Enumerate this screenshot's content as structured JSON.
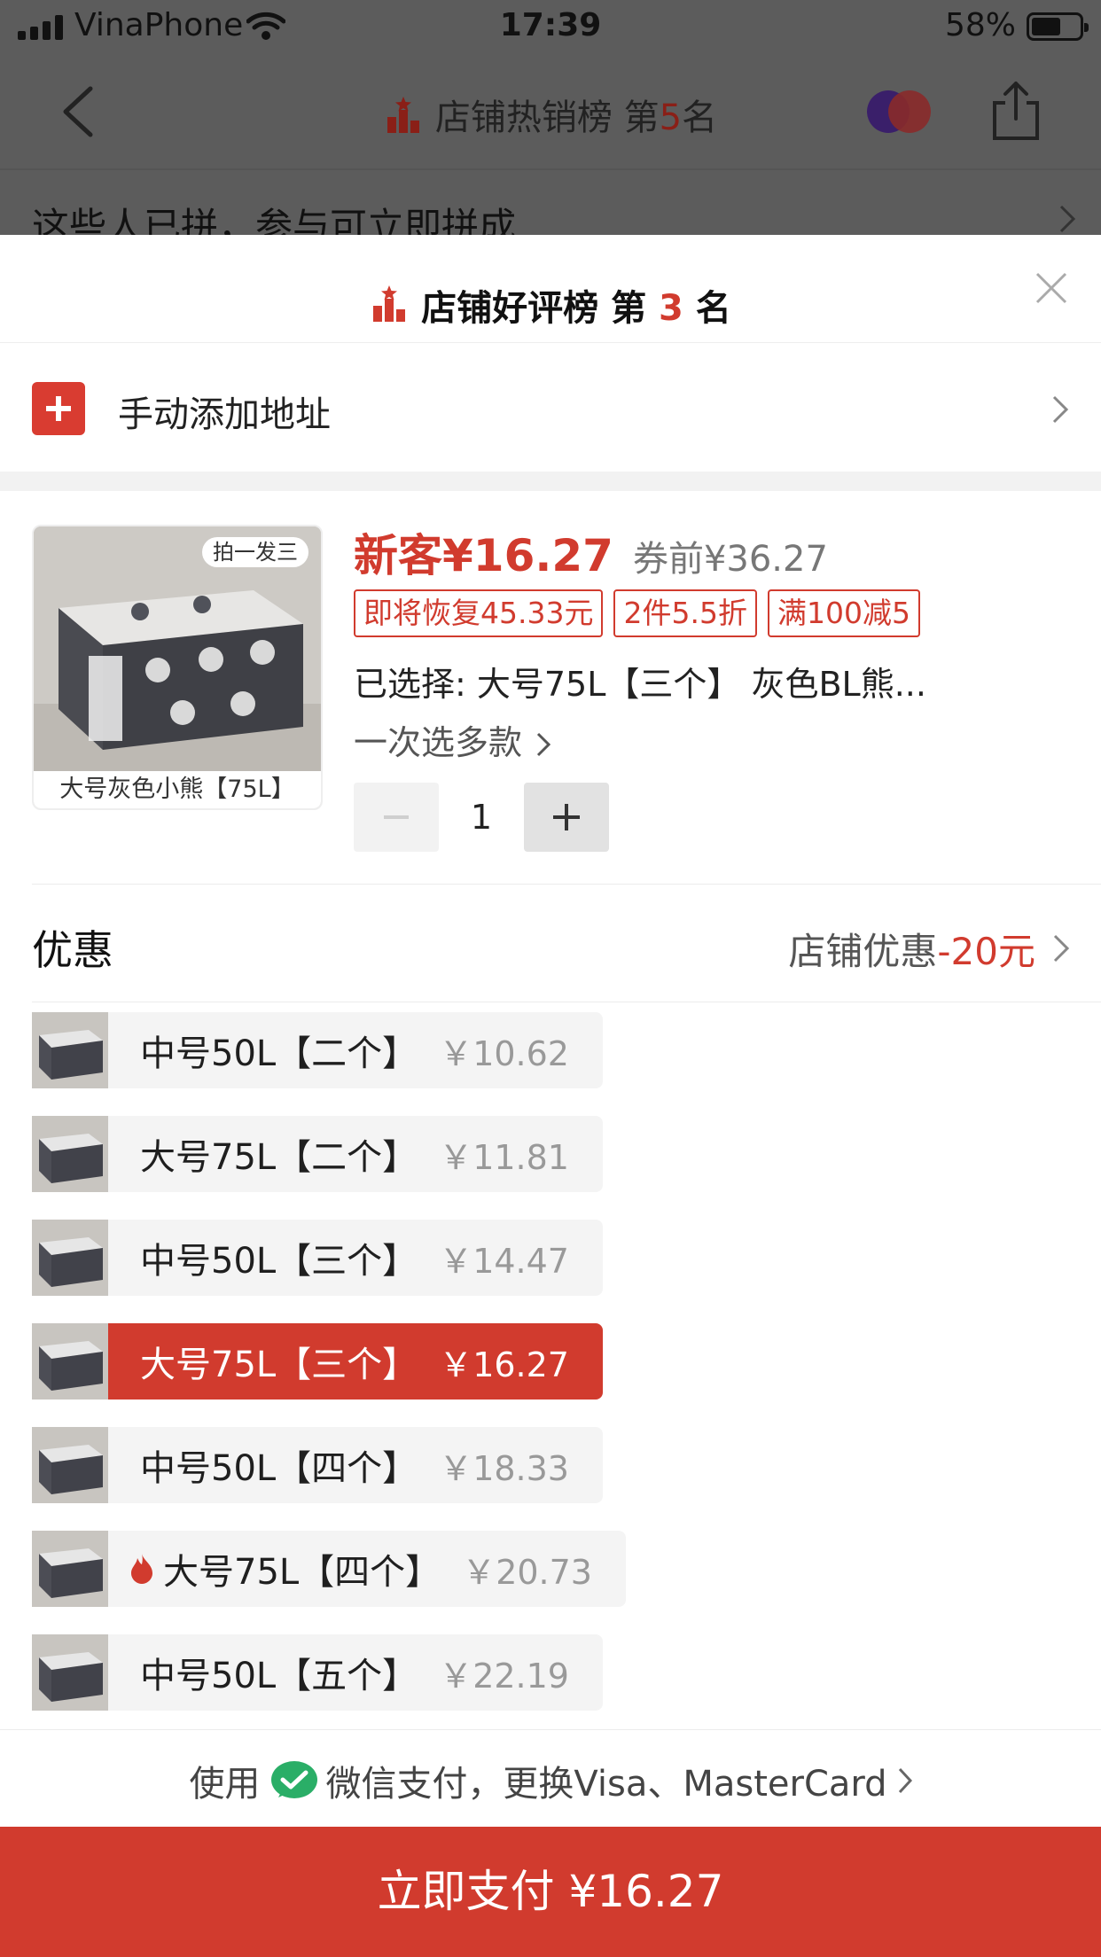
{
  "status_bar": {
    "carrier": "VinaPhone",
    "time": "17:39",
    "battery": "58%"
  },
  "background_page": {
    "title_prefix": "店铺热销榜 第",
    "title_rank": "5",
    "title_suffix": "名",
    "join_banner": "这些人已拼，参与可立即拼成"
  },
  "sheet": {
    "title_prefix": "店铺好评榜 第",
    "title_rank": "3",
    "title_suffix": "名",
    "address_label": "手动添加地址",
    "product": {
      "thumb_caption": "大号灰色小熊【75L】",
      "thumb_badge": "拍一发三",
      "price": "新客¥16.27",
      "original_price": "券前¥36.27",
      "tags": [
        "即将恢复45.33元",
        "2件5.5折",
        "满100减5"
      ],
      "selected": "已选择: 大号75L【三个】 灰色BL熊...",
      "multi_select": "一次选多款",
      "quantity": "1"
    },
    "discount": {
      "label": "优惠",
      "value_prefix": "店铺优惠",
      "value_amount": "-20元"
    },
    "variants": [
      {
        "label": "中号50L【二个】",
        "price": "￥10.62",
        "selected": false,
        "hot": false
      },
      {
        "label": "大号75L【二个】",
        "price": "￥11.81",
        "selected": false,
        "hot": false
      },
      {
        "label": "中号50L【三个】",
        "price": "￥14.47",
        "selected": false,
        "hot": false
      },
      {
        "label": "大号75L【三个】",
        "price": "￥16.27",
        "selected": true,
        "hot": false
      },
      {
        "label": "中号50L【四个】",
        "price": "￥18.33",
        "selected": false,
        "hot": false
      },
      {
        "label": "大号75L【四个】",
        "price": "￥20.73",
        "selected": false,
        "hot": true
      },
      {
        "label": "中号50L【五个】",
        "price": "￥22.19",
        "selected": false,
        "hot": false
      }
    ],
    "payment_method": {
      "prefix": "使用",
      "text": "微信支付，更换Visa、MasterCard"
    },
    "pay_button": "立即支付 ¥16.27"
  },
  "colors": {
    "accent_red": "#d13b2e",
    "wechat_green": "#2aae67"
  }
}
